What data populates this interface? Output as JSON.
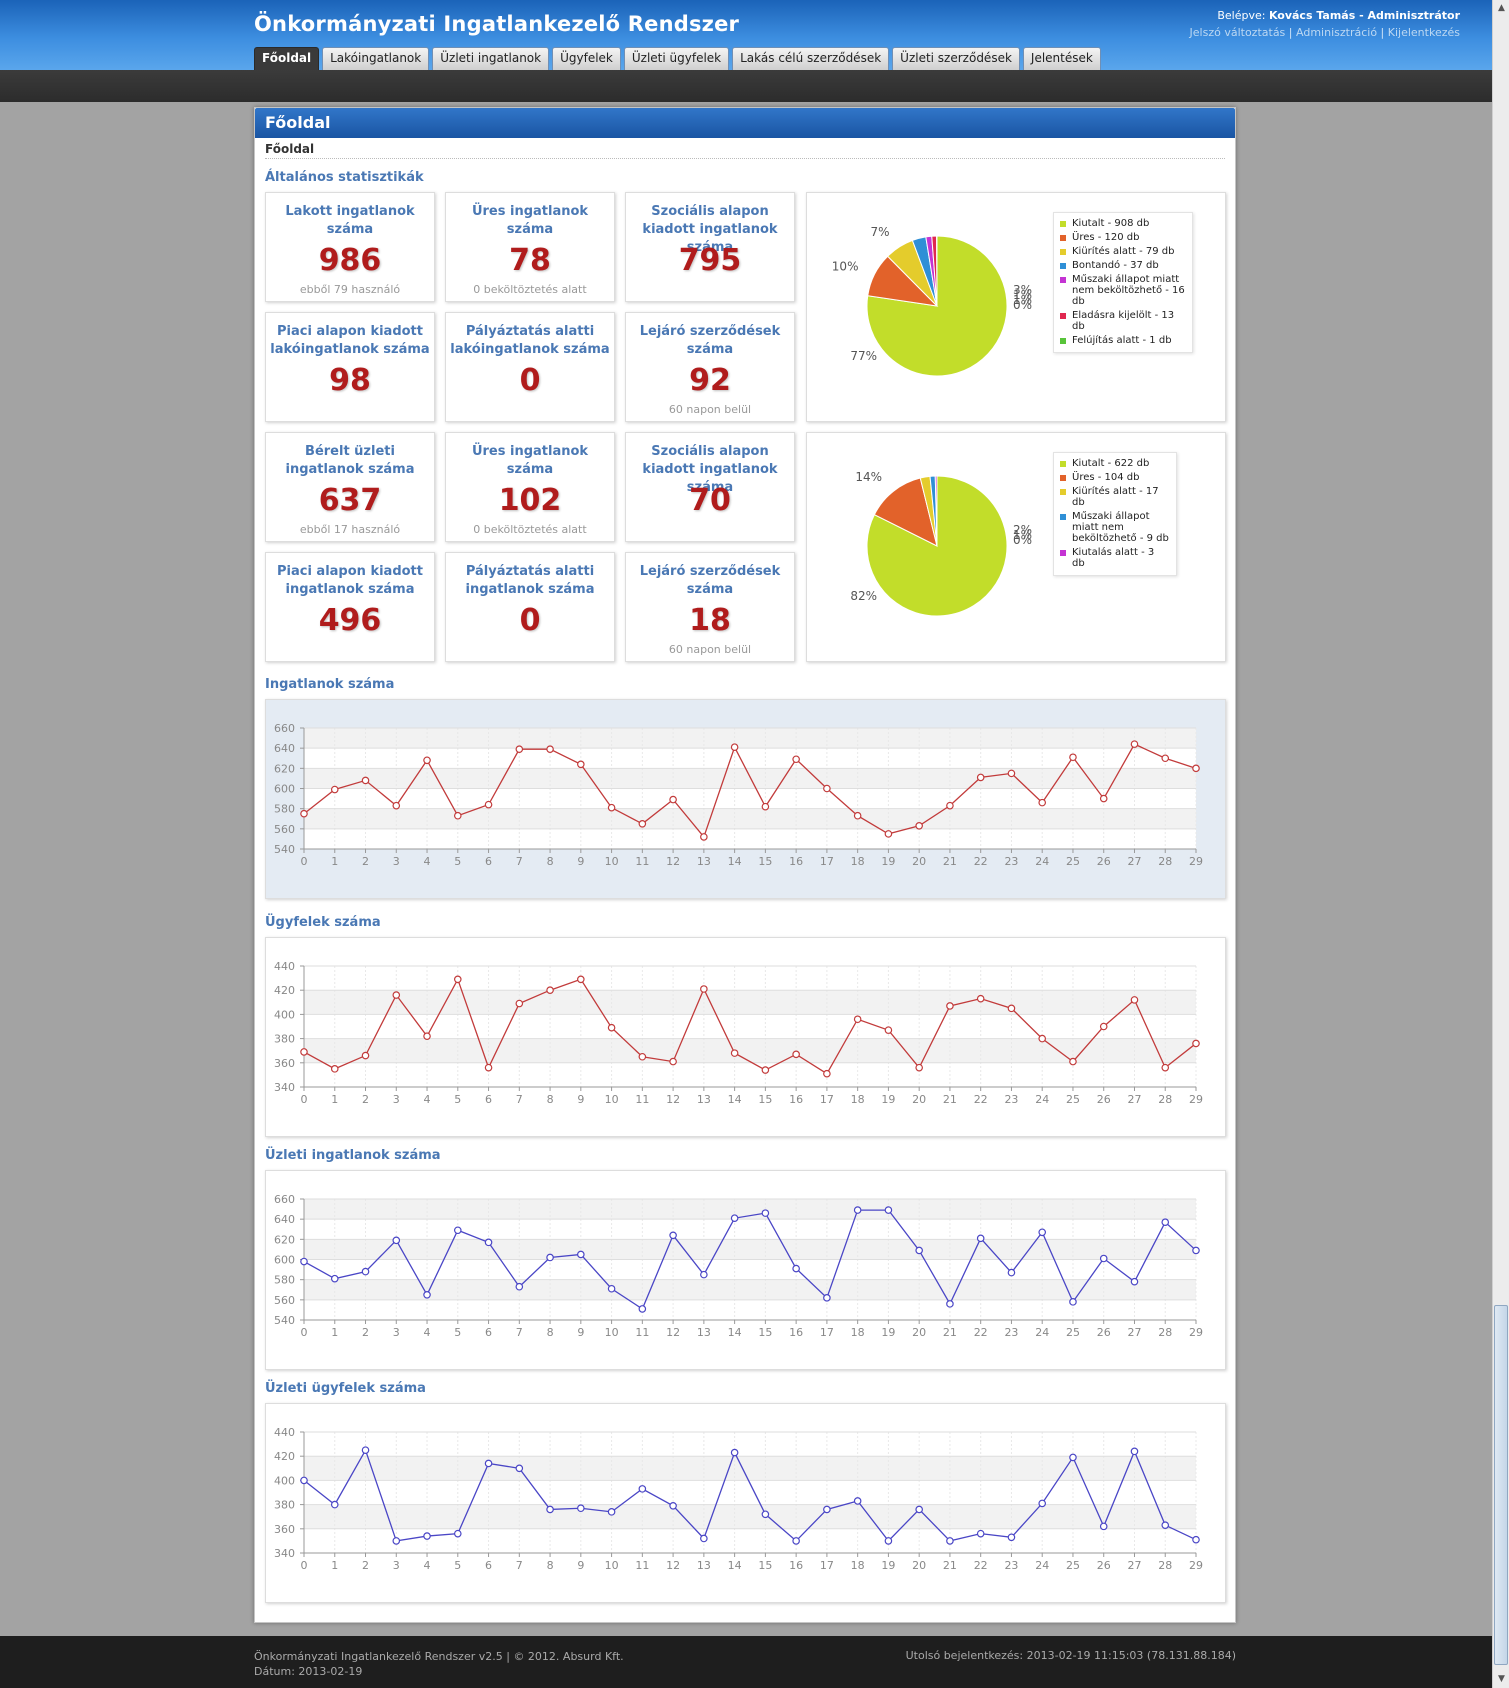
{
  "header": {
    "title": "Önkormányzati Ingatlankezelő Rendszer",
    "login_prefix": "Belépve:",
    "login_user": "Kovács Tamás - Adminisztrátor",
    "links": [
      "Jelszó változtatás",
      "Adminisztráció",
      "Kijelentkezés"
    ],
    "separator": "|"
  },
  "nav": [
    "Főoldal",
    "Lakóingatlanok",
    "Üzleti ingatlanok",
    "Ügyfelek",
    "Üzleti ügyfelek",
    "Lakás célú szerződések",
    "Üzleti szerződések",
    "Jelentések"
  ],
  "panel": {
    "title": "Főoldal",
    "breadcrumb": "Főoldal",
    "stats_title": "Általános statisztikák"
  },
  "cards": [
    {
      "label": "Lakott ingatlanok száma",
      "value": "986",
      "sub": "ebből 79 használó"
    },
    {
      "label": "Üres ingatlanok száma",
      "value": "78",
      "sub": "0 beköltöztetés alatt"
    },
    {
      "label": "Szociális alapon kiadott ingatlanok száma",
      "value": "795",
      "sub": ""
    },
    {
      "label": "Piaci alapon kiadott lakóingatlanok száma",
      "value": "98",
      "sub": ""
    },
    {
      "label": "Pályáztatás alatti lakóingatlanok száma",
      "value": "0",
      "sub": ""
    },
    {
      "label": "Lejáró szerződések száma",
      "value": "92",
      "sub": "60 napon belül"
    },
    {
      "label": "Bérelt üzleti ingatlanok száma",
      "value": "637",
      "sub": "ebből 17 használó"
    },
    {
      "label": "Üres ingatlanok száma",
      "value": "102",
      "sub": "0 beköltöztetés alatt"
    },
    {
      "label": "Szociális alapon kiadott ingatlanok száma",
      "value": "70",
      "sub": ""
    },
    {
      "label": "Piaci alapon kiadott ingatlanok száma",
      "value": "496",
      "sub": ""
    },
    {
      "label": "Pályáztatás alatti ingatlanok száma",
      "value": "0",
      "sub": ""
    },
    {
      "label": "Lejáró szerződések száma",
      "value": "18",
      "sub": "60 napon belül"
    }
  ],
  "chart_data": [
    {
      "type": "pie",
      "slices": [
        {
          "label": "Kiutalt - 908 db",
          "value": 908,
          "color": "#c2dd2a"
        },
        {
          "label": "Üres - 120 db",
          "value": 120,
          "color": "#e2622a"
        },
        {
          "label": "Kiürítés alatt - 79 db",
          "value": 79,
          "color": "#e4cc2c"
        },
        {
          "label": "Bontandó - 37 db",
          "value": 37,
          "color": "#2f8fd6"
        },
        {
          "label": "Műszaki állapot miatt nem beköltözhető - 16 db",
          "value": 16,
          "color": "#c433d3"
        },
        {
          "label": "Eladásra kijelölt - 13 db",
          "value": 13,
          "color": "#e02850"
        },
        {
          "label": "Felújítás alatt - 1 db",
          "value": 1,
          "color": "#58c43a"
        }
      ],
      "percent_labels": [
        "77%",
        "10%",
        "7%",
        "3%",
        "1%",
        "1%",
        "0%"
      ],
      "legend": "right"
    },
    {
      "type": "pie",
      "slices": [
        {
          "label": "Kiutalt - 622 db",
          "value": 622,
          "color": "#c2dd2a"
        },
        {
          "label": "Üres - 104 db",
          "value": 104,
          "color": "#e2622a"
        },
        {
          "label": "Kiürítés alatt - 17 db",
          "value": 17,
          "color": "#e4cc2c"
        },
        {
          "label": "Műszaki állapot miatt nem beköltözhető - 9 db",
          "value": 9,
          "color": "#2f8fd6"
        },
        {
          "label": "Kiutalás alatt - 3 db",
          "value": 3,
          "color": "#c433d3"
        }
      ],
      "percent_labels": [
        "82%",
        "14%",
        "2%",
        "1%",
        "0%"
      ],
      "legend": "right"
    },
    {
      "type": "line",
      "title": "Ingatlanok száma",
      "color": "#c23b3b",
      "x": [
        0,
        1,
        2,
        3,
        4,
        5,
        6,
        7,
        8,
        9,
        10,
        11,
        12,
        13,
        14,
        15,
        16,
        17,
        18,
        19,
        20,
        21,
        22,
        23,
        24,
        25,
        26,
        27,
        28,
        29
      ],
      "values": [
        575,
        599,
        608,
        583,
        628,
        573,
        584,
        639,
        639,
        624,
        581,
        565,
        589,
        552,
        641,
        582,
        629,
        600,
        573,
        555,
        563,
        583,
        611,
        615,
        586,
        631,
        590,
        644,
        630,
        620
      ],
      "ylim": [
        540,
        660
      ],
      "yticks": [
        540,
        560,
        580,
        600,
        620,
        640,
        660
      ],
      "grid": true
    },
    {
      "type": "line",
      "title": "Ügyfelek száma",
      "color": "#c23b3b",
      "x": [
        0,
        1,
        2,
        3,
        4,
        5,
        6,
        7,
        8,
        9,
        10,
        11,
        12,
        13,
        14,
        15,
        16,
        17,
        18,
        19,
        20,
        21,
        22,
        23,
        24,
        25,
        26,
        27,
        28,
        29
      ],
      "values": [
        369,
        355,
        366,
        416,
        382,
        429,
        356,
        409,
        420,
        429,
        389,
        365,
        361,
        421,
        368,
        354,
        367,
        351,
        396,
        387,
        356,
        407,
        413,
        405,
        380,
        361,
        390,
        412,
        356,
        376
      ],
      "ylim": [
        340,
        440
      ],
      "yticks": [
        340,
        360,
        380,
        400,
        420,
        440
      ],
      "grid": true
    },
    {
      "type": "line",
      "title": "Üzleti ingatlanok száma",
      "color": "#4a46c6",
      "x": [
        0,
        1,
        2,
        3,
        4,
        5,
        6,
        7,
        8,
        9,
        10,
        11,
        12,
        13,
        14,
        15,
        16,
        17,
        18,
        19,
        20,
        21,
        22,
        23,
        24,
        25,
        26,
        27,
        28,
        29
      ],
      "values": [
        598,
        581,
        588,
        619,
        565,
        629,
        617,
        573,
        602,
        605,
        571,
        551,
        624,
        585,
        641,
        646,
        591,
        562,
        649,
        649,
        609,
        556,
        621,
        587,
        627,
        558,
        601,
        578,
        637,
        609
      ],
      "ylim": [
        540,
        660
      ],
      "yticks": [
        540,
        560,
        580,
        600,
        620,
        640,
        660
      ],
      "grid": true
    },
    {
      "type": "line",
      "title": "Üzleti ügyfelek száma",
      "color": "#4a46c6",
      "x": [
        0,
        1,
        2,
        3,
        4,
        5,
        6,
        7,
        8,
        9,
        10,
        11,
        12,
        13,
        14,
        15,
        16,
        17,
        18,
        19,
        20,
        21,
        22,
        23,
        24,
        25,
        26,
        27,
        28,
        29
      ],
      "values": [
        400,
        380,
        425,
        350,
        354,
        356,
        414,
        410,
        376,
        377,
        374,
        393,
        379,
        352,
        423,
        372,
        350,
        376,
        383,
        350,
        376,
        350,
        356,
        353,
        381,
        419,
        362,
        424,
        363,
        351
      ],
      "ylim": [
        340,
        440
      ],
      "yticks": [
        340,
        360,
        380,
        400,
        420,
        440
      ],
      "grid": true
    }
  ],
  "footer": {
    "app": "Önkormányzati Ingatlankezelő Rendszer v2.5 | © 2012. Absurd Kft.",
    "date": "Dátum: 2013-02-19",
    "last_login": "Utolsó bejelentkezés: 2013-02-19 11:15:03 (78.131.88.184)"
  },
  "scrollbar": {
    "up": "▲",
    "down": "▼"
  }
}
